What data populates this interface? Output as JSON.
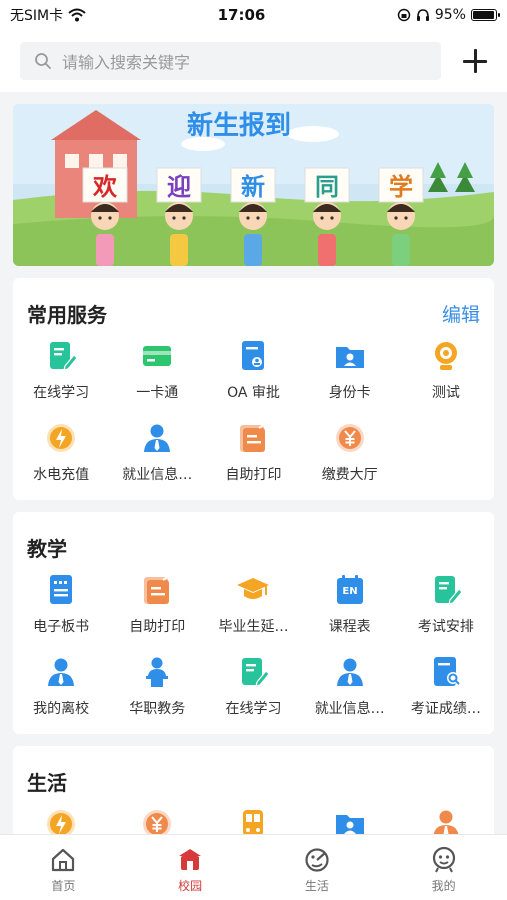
{
  "status": {
    "carrier": "无SIM卡",
    "time": "17:06",
    "battery": "95%",
    "battery_level": 0.95
  },
  "search": {
    "placeholder": "请输入搜索关键字"
  },
  "banner": {
    "title": "新生报到",
    "chars": [
      "欢",
      "迎",
      "新",
      "同",
      "学"
    ]
  },
  "services": {
    "title": "常用服务",
    "action": "编辑",
    "items": [
      {
        "label": "在线学习",
        "icon": "edit-doc-icon",
        "color": "#27c39a"
      },
      {
        "label": "一卡通",
        "icon": "card-icon",
        "color": "#2dc56e"
      },
      {
        "label": "OA 审批",
        "icon": "approval-doc-icon",
        "color": "#2f8ee8"
      },
      {
        "label": "身份卡",
        "icon": "id-card-icon",
        "color": "#2f8ee8"
      },
      {
        "label": "测试",
        "icon": "webcam-icon",
        "color": "#f5a524"
      },
      {
        "label": "水电充值",
        "icon": "flame-icon",
        "color": "#f5a524"
      },
      {
        "label": "就业信息…",
        "icon": "person-tie-icon",
        "color": "#2f8ee8"
      },
      {
        "label": "自助打印",
        "icon": "print-doc-icon",
        "color": "#f08a4b"
      },
      {
        "label": "缴费大厅",
        "icon": "yuan-coin-icon",
        "color": "#f08a4b"
      }
    ]
  },
  "teaching": {
    "title": "教学",
    "items": [
      {
        "label": "电子板书",
        "icon": "board-doc-icon",
        "color": "#2f8ee8"
      },
      {
        "label": "自助打印",
        "icon": "print-doc-icon",
        "color": "#f08a4b"
      },
      {
        "label": "毕业生延…",
        "icon": "grad-cap-icon",
        "color": "#f5a524"
      },
      {
        "label": "课程表",
        "icon": "calendar-en-icon",
        "color": "#2f8ee8"
      },
      {
        "label": "考试安排",
        "icon": "edit-doc-icon",
        "color": "#27c39a"
      },
      {
        "label": "我的离校",
        "icon": "person-tie-icon",
        "color": "#2f8ee8"
      },
      {
        "label": "华职教务",
        "icon": "podium-person-icon",
        "color": "#2f8ee8"
      },
      {
        "label": "在线学习",
        "icon": "edit-doc-icon",
        "color": "#27c39a"
      },
      {
        "label": "就业信息…",
        "icon": "person-tie-icon",
        "color": "#2f8ee8"
      },
      {
        "label": "考证成绩…",
        "icon": "search-doc-icon",
        "color": "#2f8ee8"
      }
    ]
  },
  "life": {
    "title": "生活",
    "items": [
      {
        "label": "",
        "icon": "flame-icon",
        "color": "#f5a524"
      },
      {
        "label": "",
        "icon": "yuan-coin-icon",
        "color": "#f08a4b"
      },
      {
        "label": "",
        "icon": "bus-icon",
        "color": "#f5a524"
      },
      {
        "label": "",
        "icon": "id-card-icon",
        "color": "#2f8ee8"
      },
      {
        "label": "",
        "icon": "person-tie-icon",
        "color": "#f08a4b"
      }
    ]
  },
  "tabs": [
    {
      "label": "首页",
      "icon": "home-icon",
      "active": false
    },
    {
      "label": "校园",
      "icon": "campus-icon",
      "active": true
    },
    {
      "label": "生活",
      "icon": "life-icon",
      "active": false
    },
    {
      "label": "我的",
      "icon": "profile-icon",
      "active": false
    }
  ]
}
